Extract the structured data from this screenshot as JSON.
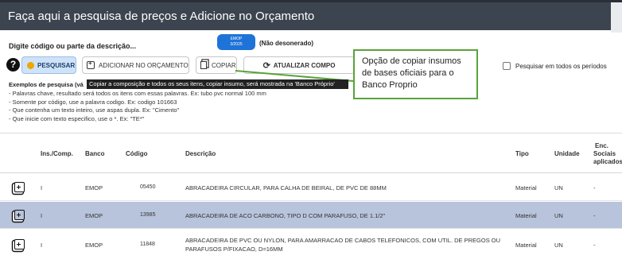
{
  "window": {
    "title": "Faça aqui a pesquisa de preços e Adicione no Orçamento"
  },
  "search": {
    "label": "Digite código ou parte da descrição...",
    "base_badge": {
      "line1": "EMOP",
      "line2": "3/2025"
    },
    "desoneracao": "(Não desonerado)",
    "help_label": "?",
    "periodos_label": "Pesquisar em todos os períodos"
  },
  "toolbar": {
    "pesquisar": "PESQUISAR",
    "adicionar": "ADICIONAR NO ORÇAMENTO",
    "copiar": "COPIAR",
    "atualizar": "ATUALIZAR COMPO"
  },
  "callout": {
    "text": "Opção de copiar insumos de bases oficiais para o Banco Proprio"
  },
  "tooltip": {
    "text": "Copiar a composição e todos os seus itens, copiar insumo, será mostrada na 'Banco Próprio'"
  },
  "examples": {
    "title": "Exemplos de pesquisa (vá",
    "lines": [
      "- Palavras chave, resultado será todos os itens com essas palavras. Ex: tubo pvc normal 100 mm",
      "- Somente por código, use a palavra codigo. Ex: codigo 101663",
      "- Que contenha um texto inteiro, use aspas dupla. Ex: \"Cimento\"",
      "- Que inicie com texto especifico, use o *. Ex: \"TE*\""
    ]
  },
  "table": {
    "headers": {
      "ins_comp": "Ins./Comp.",
      "banco": "Banco",
      "codigo": "Código",
      "descricao": "Descrição",
      "tipo": "Tipo",
      "unidade": "Unidade",
      "enc1": "Enc.",
      "enc2": "Sociais",
      "enc3": "aplicados"
    },
    "rows": [
      {
        "ins": "I",
        "banco": "EMOP",
        "codigo": "05450",
        "descricao": "ABRACADEIRA CIRCULAR, PARA CALHA DE BEIRAL, DE PVC DE 88MM",
        "descricao2": "",
        "tipo": "Material",
        "unidade": "UN",
        "enc": "-"
      },
      {
        "ins": "I",
        "banco": "EMOP",
        "codigo": "13985",
        "descricao": "ABRACADEIRA DE ACO CARBONO, TIPO D COM PARAFUSO, DE 1.1/2\"",
        "descricao2": "",
        "tipo": "Material",
        "unidade": "UN",
        "enc": "-"
      },
      {
        "ins": "I",
        "banco": "EMOP",
        "codigo": "11848",
        "descricao": "ABRACADEIRA DE PVC OU NYLON, PARA AMARRACAO DE CABOS TELEFONICOS, COM UTIL. DE PREGOS OU",
        "descricao2": "PARAFUSOS P/FIXACAO, D=16MM",
        "tipo": "Material",
        "unidade": "UN",
        "enc": "-"
      }
    ]
  }
}
